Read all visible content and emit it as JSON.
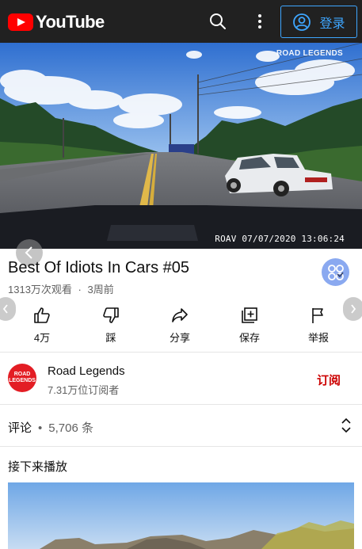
{
  "header": {
    "logo_text": "YouTube",
    "login_label": "登录",
    "accent": "#3ea6ff",
    "brand": "#ff0000"
  },
  "video": {
    "watermark": "ROAD LEGENDS",
    "timestamp": "ROAV 07/07/2020 13:06:24"
  },
  "info": {
    "title": "Best Of Idiots In Cars #05",
    "views": "1313万次观看",
    "age": "3周前",
    "separator": "·"
  },
  "actions": [
    {
      "name": "like",
      "label": "4万"
    },
    {
      "name": "dislike",
      "label": "踩"
    },
    {
      "name": "share",
      "label": "分享"
    },
    {
      "name": "save",
      "label": "保存"
    },
    {
      "name": "report",
      "label": "举报"
    }
  ],
  "channel": {
    "avatar_text": "ROAD LEGENDS",
    "name": "Road Legends",
    "subscribers": "7.31万位订阅者",
    "subscribe_label": "订阅"
  },
  "comments": {
    "label": "评论",
    "separator": "•",
    "count": "5,706 条"
  },
  "up_next": {
    "label": "接下来播放"
  }
}
